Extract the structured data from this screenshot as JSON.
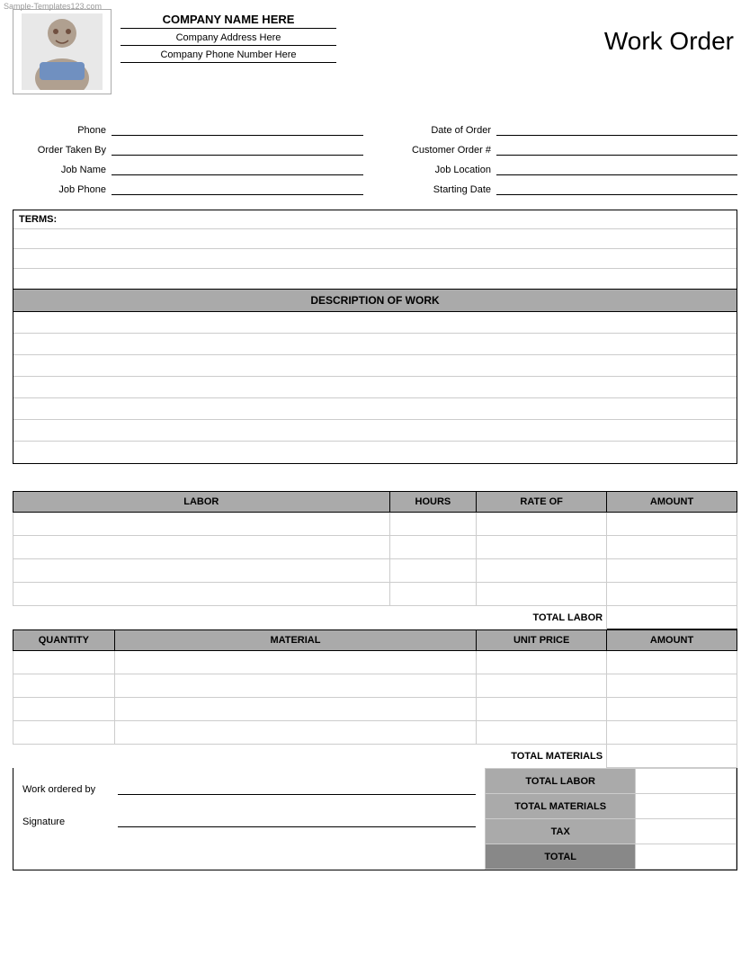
{
  "watermark": "Sample-Templates123.com",
  "header": {
    "company_name": "COMPANY NAME HERE",
    "company_address": "Company Address Here",
    "company_phone": "Company Phone Number Here",
    "title": "Work Order"
  },
  "form": {
    "left_fields": [
      {
        "label": "Phone",
        "value": ""
      },
      {
        "label": "Order Taken By",
        "value": ""
      },
      {
        "label": "Job Name",
        "value": ""
      },
      {
        "label": "Job Phone",
        "value": ""
      }
    ],
    "right_fields": [
      {
        "label": "Date of Order",
        "value": ""
      },
      {
        "label": "Customer Order #",
        "value": ""
      },
      {
        "label": "Job Location",
        "value": ""
      },
      {
        "label": "Starting Date",
        "value": ""
      }
    ]
  },
  "terms": {
    "label": "TERMS:",
    "rows": 3
  },
  "description": {
    "header": "DESCRIPTION OF WORK",
    "rows": 7
  },
  "labor": {
    "columns": [
      "LABOR",
      "HOURS",
      "RATE OF",
      "AMOUNT"
    ],
    "rows": 4,
    "total_label": "TOTAL LABOR"
  },
  "material": {
    "columns": [
      "QUANTITY",
      "MATERIAL",
      "UNIT PRICE",
      "AMOUNT"
    ],
    "rows": 4,
    "total_label": "TOTAL MATERIALS"
  },
  "summary": {
    "work_ordered_by_label": "Work ordered by",
    "signature_label": "Signature",
    "totals": [
      {
        "label": "TOTAL LABOR",
        "value": ""
      },
      {
        "label": "TOTAL MATERIALS",
        "value": ""
      },
      {
        "label": "TAX",
        "value": ""
      },
      {
        "label": "TOTAL",
        "value": "",
        "dark": true
      }
    ]
  },
  "colors": {
    "header_bg": "#aaaaaa",
    "dark_header_bg": "#888888",
    "border": "#000000",
    "cell_border": "#cccccc"
  }
}
